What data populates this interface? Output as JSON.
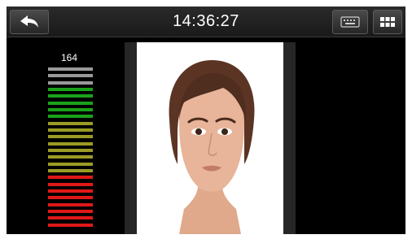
{
  "header": {
    "time": "14:36:27",
    "back_icon": "back-arrow-icon",
    "keyboard_icon": "keyboard-icon",
    "menu_icon": "grid-menu-icon"
  },
  "quality_meter": {
    "value": "164",
    "segments": 24,
    "colors": {
      "gray": "#9a9a9a",
      "green": "#1aa21a",
      "olive": "#9b9b25",
      "red": "#e01818"
    },
    "segment_groups": [
      {
        "color": "gray",
        "count": 3
      },
      {
        "color": "green",
        "count": 5
      },
      {
        "color": "olive",
        "count": 8
      },
      {
        "color": "red",
        "count": 8
      }
    ]
  },
  "colors": {
    "screen_bg": "#000000",
    "topbar_bg": "#222222"
  }
}
